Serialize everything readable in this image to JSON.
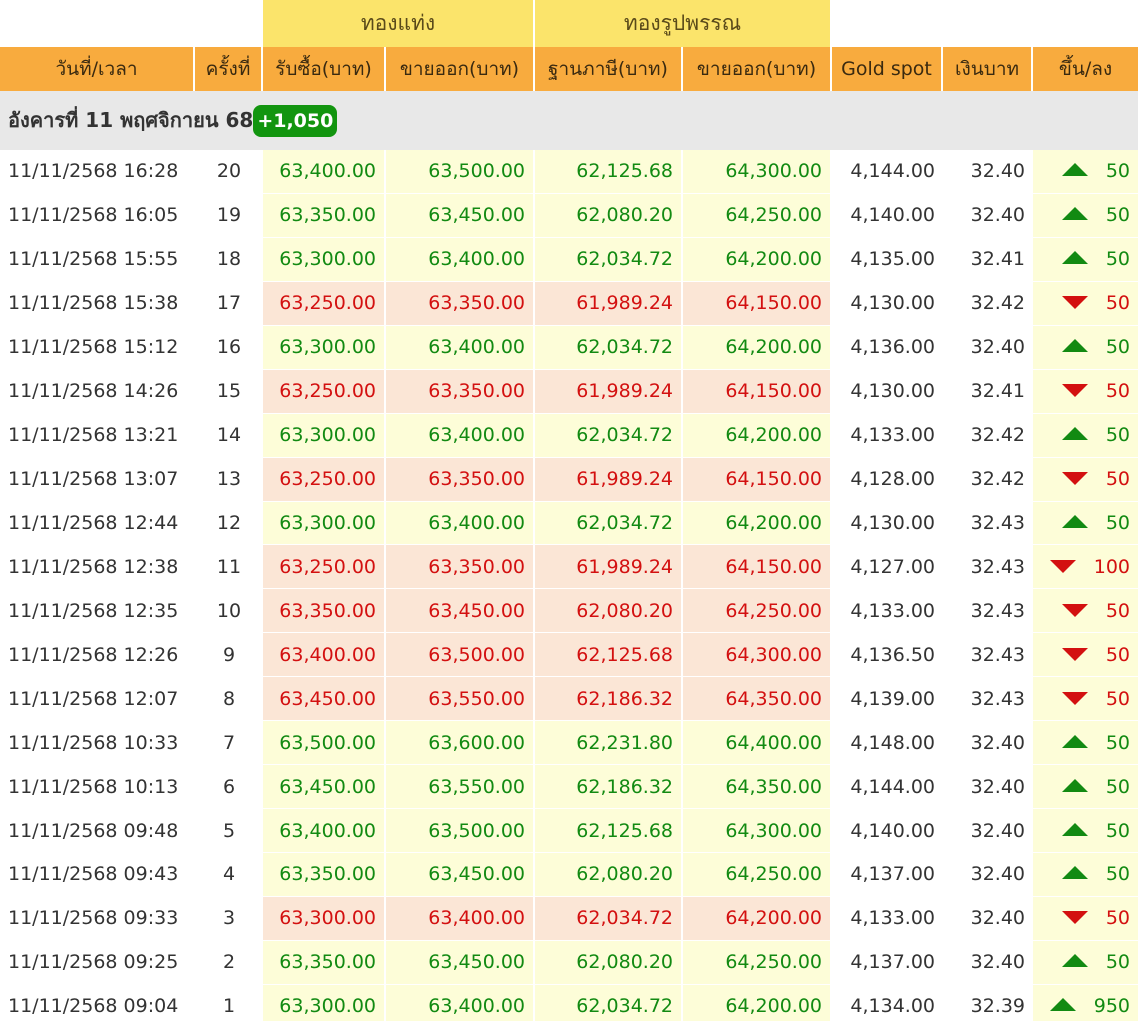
{
  "groups": {
    "bar": "ทองแท่ง",
    "ornament": "ทองรูปพรรณ"
  },
  "headers": {
    "datetime": "วันที่/เวลา",
    "round": "ครั้งที่",
    "bar_buy": "รับซื้อ(บาท)",
    "bar_sell": "ขายออก(บาท)",
    "ornament_base": "ฐานภาษี(บาท)",
    "ornament_sell": "ขายออก(บาท)",
    "spot": "Gold spot",
    "thb": "เงินบาท",
    "change": "ขึ้น/ลง"
  },
  "day": {
    "label": "อังคารที่ 11 พฤศจิกายน 68",
    "total_change": "+1,050"
  },
  "colors": {
    "up": "#128a12",
    "down": "#d31010",
    "header": "#f8ab3e",
    "group": "#fbe46b",
    "badge": "#12950f"
  },
  "rows": [
    {
      "datetime": "11/11/2568 16:28",
      "round": "20",
      "bar_buy": "63,400.00",
      "bar_sell": "63,500.00",
      "orn_base": "62,125.68",
      "orn_sell": "64,300.00",
      "spot": "4,144.00",
      "thb": "32.40",
      "dir": "up",
      "change": "50"
    },
    {
      "datetime": "11/11/2568 16:05",
      "round": "19",
      "bar_buy": "63,350.00",
      "bar_sell": "63,450.00",
      "orn_base": "62,080.20",
      "orn_sell": "64,250.00",
      "spot": "4,140.00",
      "thb": "32.40",
      "dir": "up",
      "change": "50"
    },
    {
      "datetime": "11/11/2568 15:55",
      "round": "18",
      "bar_buy": "63,300.00",
      "bar_sell": "63,400.00",
      "orn_base": "62,034.72",
      "orn_sell": "64,200.00",
      "spot": "4,135.00",
      "thb": "32.41",
      "dir": "up",
      "change": "50"
    },
    {
      "datetime": "11/11/2568 15:38",
      "round": "17",
      "bar_buy": "63,250.00",
      "bar_sell": "63,350.00",
      "orn_base": "61,989.24",
      "orn_sell": "64,150.00",
      "spot": "4,130.00",
      "thb": "32.42",
      "dir": "down",
      "change": "50"
    },
    {
      "datetime": "11/11/2568 15:12",
      "round": "16",
      "bar_buy": "63,300.00",
      "bar_sell": "63,400.00",
      "orn_base": "62,034.72",
      "orn_sell": "64,200.00",
      "spot": "4,136.00",
      "thb": "32.40",
      "dir": "up",
      "change": "50"
    },
    {
      "datetime": "11/11/2568 14:26",
      "round": "15",
      "bar_buy": "63,250.00",
      "bar_sell": "63,350.00",
      "orn_base": "61,989.24",
      "orn_sell": "64,150.00",
      "spot": "4,130.00",
      "thb": "32.41",
      "dir": "down",
      "change": "50"
    },
    {
      "datetime": "11/11/2568 13:21",
      "round": "14",
      "bar_buy": "63,300.00",
      "bar_sell": "63,400.00",
      "orn_base": "62,034.72",
      "orn_sell": "64,200.00",
      "spot": "4,133.00",
      "thb": "32.42",
      "dir": "up",
      "change": "50"
    },
    {
      "datetime": "11/11/2568 13:07",
      "round": "13",
      "bar_buy": "63,250.00",
      "bar_sell": "63,350.00",
      "orn_base": "61,989.24",
      "orn_sell": "64,150.00",
      "spot": "4,128.00",
      "thb": "32.42",
      "dir": "down",
      "change": "50"
    },
    {
      "datetime": "11/11/2568 12:44",
      "round": "12",
      "bar_buy": "63,300.00",
      "bar_sell": "63,400.00",
      "orn_base": "62,034.72",
      "orn_sell": "64,200.00",
      "spot": "4,130.00",
      "thb": "32.43",
      "dir": "up",
      "change": "50"
    },
    {
      "datetime": "11/11/2568 12:38",
      "round": "11",
      "bar_buy": "63,250.00",
      "bar_sell": "63,350.00",
      "orn_base": "61,989.24",
      "orn_sell": "64,150.00",
      "spot": "4,127.00",
      "thb": "32.43",
      "dir": "down",
      "change": "100"
    },
    {
      "datetime": "11/11/2568 12:35",
      "round": "10",
      "bar_buy": "63,350.00",
      "bar_sell": "63,450.00",
      "orn_base": "62,080.20",
      "orn_sell": "64,250.00",
      "spot": "4,133.00",
      "thb": "32.43",
      "dir": "down",
      "change": "50"
    },
    {
      "datetime": "11/11/2568 12:26",
      "round": "9",
      "bar_buy": "63,400.00",
      "bar_sell": "63,500.00",
      "orn_base": "62,125.68",
      "orn_sell": "64,300.00",
      "spot": "4,136.50",
      "thb": "32.43",
      "dir": "down",
      "change": "50"
    },
    {
      "datetime": "11/11/2568 12:07",
      "round": "8",
      "bar_buy": "63,450.00",
      "bar_sell": "63,550.00",
      "orn_base": "62,186.32",
      "orn_sell": "64,350.00",
      "spot": "4,139.00",
      "thb": "32.43",
      "dir": "down",
      "change": "50"
    },
    {
      "datetime": "11/11/2568 10:33",
      "round": "7",
      "bar_buy": "63,500.00",
      "bar_sell": "63,600.00",
      "orn_base": "62,231.80",
      "orn_sell": "64,400.00",
      "spot": "4,148.00",
      "thb": "32.40",
      "dir": "up",
      "change": "50"
    },
    {
      "datetime": "11/11/2568 10:13",
      "round": "6",
      "bar_buy": "63,450.00",
      "bar_sell": "63,550.00",
      "orn_base": "62,186.32",
      "orn_sell": "64,350.00",
      "spot": "4,144.00",
      "thb": "32.40",
      "dir": "up",
      "change": "50"
    },
    {
      "datetime": "11/11/2568 09:48",
      "round": "5",
      "bar_buy": "63,400.00",
      "bar_sell": "63,500.00",
      "orn_base": "62,125.68",
      "orn_sell": "64,300.00",
      "spot": "4,140.00",
      "thb": "32.40",
      "dir": "up",
      "change": "50"
    },
    {
      "datetime": "11/11/2568 09:43",
      "round": "4",
      "bar_buy": "63,350.00",
      "bar_sell": "63,450.00",
      "orn_base": "62,080.20",
      "orn_sell": "64,250.00",
      "spot": "4,137.00",
      "thb": "32.40",
      "dir": "up",
      "change": "50"
    },
    {
      "datetime": "11/11/2568 09:33",
      "round": "3",
      "bar_buy": "63,300.00",
      "bar_sell": "63,400.00",
      "orn_base": "62,034.72",
      "orn_sell": "64,200.00",
      "spot": "4,133.00",
      "thb": "32.40",
      "dir": "down",
      "change": "50"
    },
    {
      "datetime": "11/11/2568 09:25",
      "round": "2",
      "bar_buy": "63,350.00",
      "bar_sell": "63,450.00",
      "orn_base": "62,080.20",
      "orn_sell": "64,250.00",
      "spot": "4,137.00",
      "thb": "32.40",
      "dir": "up",
      "change": "50"
    },
    {
      "datetime": "11/11/2568 09:04",
      "round": "1",
      "bar_buy": "63,300.00",
      "bar_sell": "63,400.00",
      "orn_base": "62,034.72",
      "orn_sell": "64,200.00",
      "spot": "4,134.00",
      "thb": "32.39",
      "dir": "up",
      "change": "950"
    }
  ]
}
